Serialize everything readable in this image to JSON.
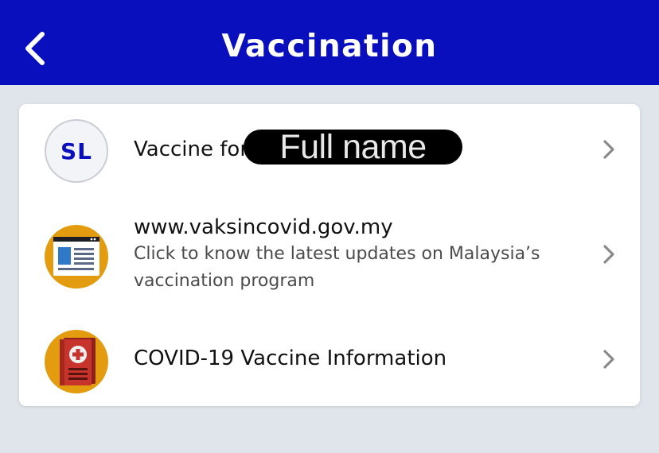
{
  "header": {
    "title": "Vaccination",
    "back_icon": "chevron-left-icon",
    "background_color": "#0a0fbd"
  },
  "items": [
    {
      "avatar_initials": "SL",
      "label": "Vaccine for",
      "redacted_text": "Full name",
      "chevron_icon": "chevron-right-icon"
    },
    {
      "icon": "webpage-icon",
      "title": "www.vaksincovid.gov.my",
      "subtitle_line1": "Click to know the latest updates on Malaysia’s",
      "subtitle_line2": "vaccination program",
      "chevron_icon": "chevron-right-icon"
    },
    {
      "icon": "medical-book-icon",
      "title": "COVID-19 Vaccine Information",
      "chevron_icon": "chevron-right-icon"
    }
  ],
  "colors": {
    "accent": "#0a0fbd",
    "page_background": "#dfe5ea",
    "icon_orange": "#e39c0f",
    "book_red": "#c7342b"
  }
}
